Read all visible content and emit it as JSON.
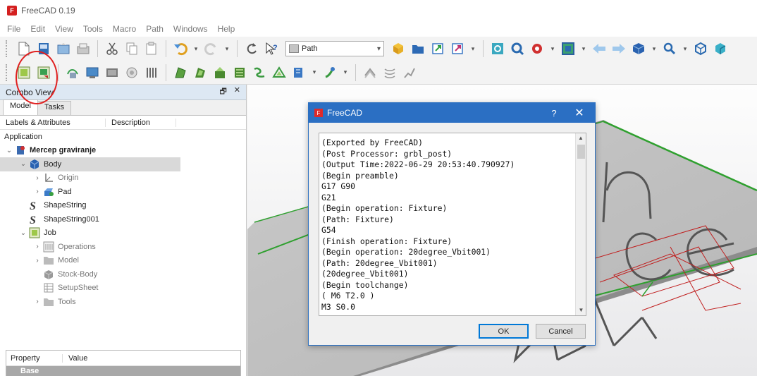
{
  "window": {
    "title": "FreeCAD 0.19"
  },
  "menu": [
    "File",
    "Edit",
    "View",
    "Tools",
    "Macro",
    "Path",
    "Windows",
    "Help"
  ],
  "toolbar": {
    "workbench": "Path",
    "row1_icons": [
      "new-document-icon",
      "open-document-icon",
      "save-icon",
      "save-as-icon",
      "cut-icon",
      "copy-icon",
      "paste-icon",
      "undo-icon",
      "redo-icon",
      "refresh-icon",
      "whats-this-icon"
    ],
    "row1b_icons": [
      "part-icon",
      "folder-icon",
      "link-icon",
      "link-actions-icon",
      "fit-all-icon",
      "fit-selection-icon",
      "draw-style-icon",
      "bounding-box-icon",
      "back-icon",
      "forward-icon",
      "std-views-icon",
      "measure-icon",
      "view-isometric-icon",
      "view-front-icon"
    ],
    "row2_icons": [
      "job-icon",
      "post-process-icon",
      "inspect-gcode-icon",
      "simulator-icon",
      "stock-icon",
      "drill-icon",
      "face-icon",
      "profile-icon",
      "pocket-icon",
      "adaptive-icon",
      "helix-icon",
      "engrave-icon",
      "vcarve-icon",
      "dressup-icon",
      "array-icon",
      "slot-icon",
      "waterline-icon"
    ]
  },
  "combo_view": {
    "title": "Combo View",
    "tabs": [
      "Model",
      "Tasks"
    ],
    "columns": [
      "Labels & Attributes",
      "Description"
    ],
    "section": "Application",
    "tree": [
      {
        "label": "Mercep graviranje",
        "indent": 0,
        "expand": "v",
        "icon": "document-icon",
        "bold": true
      },
      {
        "label": "Body",
        "indent": 1,
        "expand": "v",
        "icon": "body-icon",
        "selected": true
      },
      {
        "label": "Origin",
        "indent": 2,
        "expand": ">",
        "icon": "origin-icon",
        "grey": true
      },
      {
        "label": "Pad",
        "indent": 2,
        "expand": ">",
        "icon": "pad-icon"
      },
      {
        "label": "ShapeString",
        "indent": 1,
        "expand": "",
        "icon": "shapestring-icon"
      },
      {
        "label": "ShapeString001",
        "indent": 1,
        "expand": "",
        "icon": "shapestring-icon"
      },
      {
        "label": "Job",
        "indent": 1,
        "expand": "v",
        "icon": "job-icon"
      },
      {
        "label": "Operations",
        "indent": 2,
        "expand": ">",
        "icon": "operations-icon",
        "grey": true
      },
      {
        "label": "Model",
        "indent": 2,
        "expand": ">",
        "icon": "folder-icon",
        "grey": true
      },
      {
        "label": "Stock-Body",
        "indent": 2,
        "expand": "",
        "icon": "stock-icon",
        "grey": true
      },
      {
        "label": "SetupSheet",
        "indent": 2,
        "expand": "",
        "icon": "setupsheet-icon",
        "grey": true
      },
      {
        "label": "Tools",
        "indent": 2,
        "expand": ">",
        "icon": "folder-icon",
        "grey": true
      }
    ]
  },
  "property_panel": {
    "columns": [
      "Property",
      "Value"
    ],
    "group": "Base"
  },
  "viewport": {
    "engraved_text": [
      "n",
      "cep",
      "Me"
    ]
  },
  "dialog": {
    "title": "FreeCAD",
    "help": "?",
    "close": "✕",
    "lines": [
      "(Exported by FreeCAD)",
      "(Post Processor: grbl_post)",
      "(Output Time:2022-06-29 20:53:40.790927)",
      "(Begin preamble)",
      "G17 G90",
      "G21",
      "(Begin operation: Fixture)",
      "(Path: Fixture)",
      "G54",
      "(Finish operation: Fixture)",
      "(Begin operation: 20degree_Vbit001)",
      "(Path: 20degree_Vbit001)",
      "(20degree_Vbit001)",
      "(Begin toolchange)",
      "( M6 T2.0 )",
      "M3 S0.0"
    ],
    "ok": "OK",
    "cancel": "Cancel"
  }
}
